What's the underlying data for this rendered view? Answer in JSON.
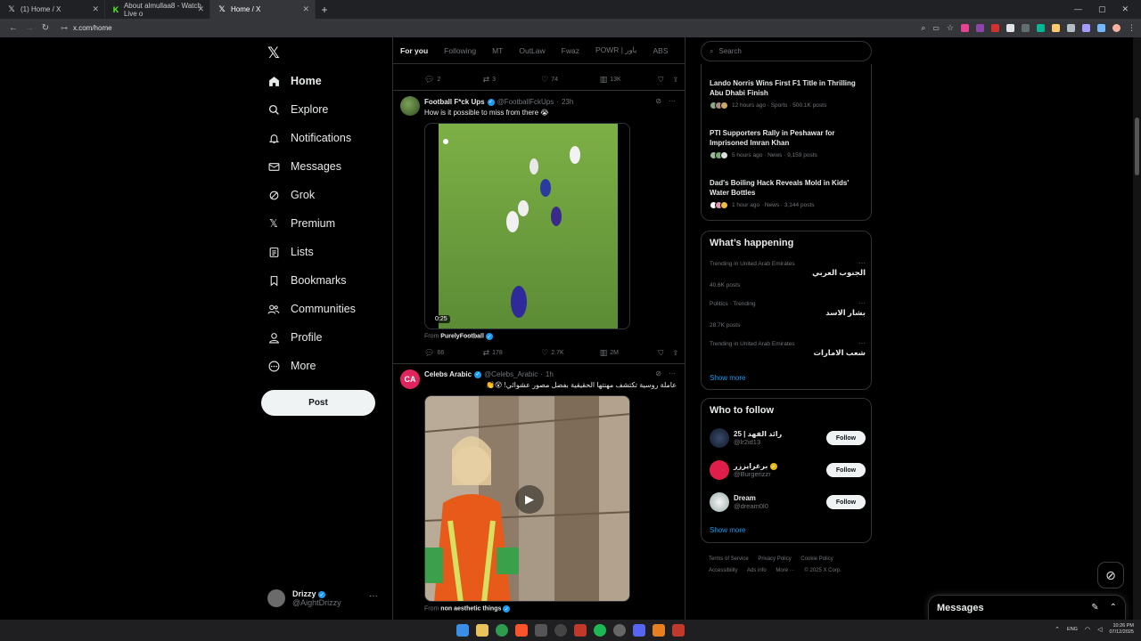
{
  "browser": {
    "tabs": [
      {
        "title": "(1) Home / X",
        "favicon": "x-icon"
      },
      {
        "title": "About almullaa8 - Watch Live o",
        "favicon": "kick-icon"
      },
      {
        "title": "Home / X",
        "favicon": "x-icon",
        "active": true
      }
    ],
    "url": "x.com/home"
  },
  "nav": {
    "items": [
      {
        "label": "Home",
        "icon": "home-icon"
      },
      {
        "label": "Explore",
        "icon": "search-icon"
      },
      {
        "label": "Notifications",
        "icon": "bell-icon"
      },
      {
        "label": "Messages",
        "icon": "envelope-icon"
      },
      {
        "label": "Grok",
        "icon": "grok-icon"
      },
      {
        "label": "Premium",
        "icon": "x-icon"
      },
      {
        "label": "Lists",
        "icon": "list-icon"
      },
      {
        "label": "Bookmarks",
        "icon": "bookmark-icon"
      },
      {
        "label": "Communities",
        "icon": "people-icon"
      },
      {
        "label": "Profile",
        "icon": "person-icon"
      },
      {
        "label": "More",
        "icon": "more-circle-icon"
      }
    ],
    "post_label": "Post",
    "account": {
      "name": "Drizzy",
      "handle": "@AightDrizzy"
    }
  },
  "feed": {
    "tabs": [
      "For you",
      "Following",
      "MT",
      "OutLaw",
      "Fwaz",
      "POWR | باور",
      "ABS"
    ],
    "top_actions": {
      "replies": "2",
      "reposts": "3",
      "likes": "74",
      "views": "13K"
    },
    "tweets": [
      {
        "name": "Football F*ck Ups",
        "handle": "@FootballFckUps",
        "time": "23h",
        "text": "How is it possible to miss from there 😭",
        "duration": "0:25",
        "from_label": "From",
        "from_source": "PurelyFootball",
        "replies": "66",
        "reposts": "178",
        "likes": "2.7K",
        "views": "2M"
      },
      {
        "name": "Celebs Arabic",
        "handle": "@Celebs_Arabic",
        "time": "1h",
        "text": "عاملة روسية تكتشف مهنتها الحقيقية بفضل مصور عشوائي! 😲👏",
        "from_label": "From",
        "from_source": "non aesthetic things"
      }
    ]
  },
  "right": {
    "search_placeholder": "Search",
    "news": [
      {
        "title": "Lando Norris Wins First F1 Title in Thrilling Abu Dhabi Finish",
        "meta": "12 hours ago · Sports · 500.1K posts"
      },
      {
        "title": "PTI Supporters Rally in Peshawar for Imprisoned Imran Khan",
        "meta": "5 hours ago · News · 9,159 posts"
      },
      {
        "title": "Dad's Boiling Hack Reveals Mold in Kids' Water Bottles",
        "meta": "1 hour ago · News · 3,144 posts"
      }
    ],
    "happening": {
      "title": "What’s happening",
      "trends": [
        {
          "context": "Trending in United Arab Emirates",
          "name": "الجنوب العربي",
          "posts": "40.6K posts"
        },
        {
          "context": "Politics · Trending",
          "name": "بشار الاسد",
          "posts": "28.7K posts"
        },
        {
          "context": "Trending in United Arab Emirates",
          "name": "شعب الامارات",
          "posts": ""
        }
      ],
      "show_more": "Show more"
    },
    "who_to_follow": {
      "title": "Who to follow",
      "accounts": [
        {
          "name": "رائد الفهد | 25",
          "handle": "@lr2id13",
          "button": "Follow"
        },
        {
          "name": "برغرايززر",
          "handle": "@Burgerizzr",
          "button": "Follow"
        },
        {
          "name": "Dream",
          "handle": "@dream0l0",
          "button": "Follow"
        }
      ],
      "show_more": "Show more"
    },
    "footer": {
      "line1": [
        "Terms of Service",
        "Privacy Policy",
        "Cookie Policy"
      ],
      "line2": [
        "Accessibility",
        "Ads info",
        "More ···",
        "© 2025 X Corp."
      ]
    }
  },
  "messages_drawer": {
    "title": "Messages"
  },
  "taskbar": {
    "lang": "ENG",
    "time": "10:26 PM",
    "date": "07/12/2025"
  }
}
